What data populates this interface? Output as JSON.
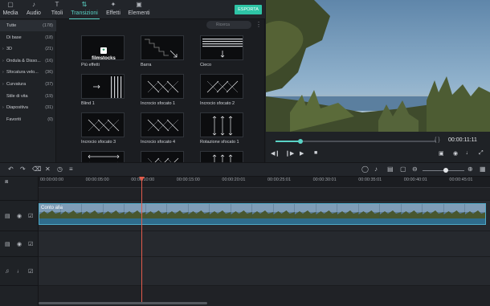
{
  "top_tabs": [
    {
      "label": "Media",
      "icon": "folder-icon"
    },
    {
      "label": "Audio",
      "icon": "music-note-icon"
    },
    {
      "label": "Titoli",
      "icon": "text-icon"
    },
    {
      "label": "Transizioni",
      "icon": "transition-icon",
      "active": true
    },
    {
      "label": "Effetti",
      "icon": "effects-icon"
    },
    {
      "label": "Elementi",
      "icon": "elements-icon"
    }
  ],
  "export_label": "ESPORTA",
  "search": {
    "placeholder": "Ricerca"
  },
  "categories": [
    {
      "name": "Tutte",
      "count": "(178)",
      "arrow": "",
      "selected": true
    },
    {
      "name": "Di base",
      "count": "(18)",
      "arrow": ""
    },
    {
      "name": "3D",
      "count": "(21)",
      "arrow": "›"
    },
    {
      "name": "Ondula & Disso...",
      "count": "(16)",
      "arrow": "›"
    },
    {
      "name": "Sfocatura velo...",
      "count": "(36)",
      "arrow": "›"
    },
    {
      "name": "Curvatura",
      "count": "(37)",
      "arrow": "›"
    },
    {
      "name": "Stile di vita",
      "count": "(19)",
      "arrow": ""
    },
    {
      "name": "Diapositiva",
      "count": "(31)",
      "arrow": "›"
    },
    {
      "name": "Favoriti",
      "count": "(0)",
      "arrow": ""
    }
  ],
  "transitions": [
    {
      "label": "Più effetti",
      "kind": "filmstocks",
      "logo_text": "filmstocks"
    },
    {
      "label": "Barra",
      "kind": "stairs"
    },
    {
      "label": "Cieco",
      "kind": "blinds-h"
    },
    {
      "label": "Blind 1",
      "kind": "blinds-v"
    },
    {
      "label": "Incrocio sfocato 1",
      "kind": "diag-a"
    },
    {
      "label": "Incrocio sfocato 2",
      "kind": "diag-b"
    },
    {
      "label": "Incrocio sfocato 3",
      "kind": "diag-c"
    },
    {
      "label": "Incrocio sfocato 4",
      "kind": "diag-a"
    },
    {
      "label": "Rotazione sfocato 1",
      "kind": "vert-arrows"
    },
    {
      "label": "",
      "kind": "horiz-arrows"
    },
    {
      "label": "",
      "kind": "diag-b"
    },
    {
      "label": "",
      "kind": "vert-arrows"
    }
  ],
  "preview": {
    "timecode": "00:00:11:11",
    "braces": "{  }",
    "progress": 0.155
  },
  "ruler_ticks": [
    "00:00:00:00",
    "00:00:05:00",
    "00:00:10:00",
    "00:00:15:00",
    "00:00:20:01",
    "00:00:25:01",
    "00:00:30:01",
    "00:00:35:01",
    "00:00:40:01",
    "00:00:45:01"
  ],
  "clip": {
    "label": "Conto alla",
    "color": "#4fa9c7"
  },
  "tracks": [
    {
      "name": "video-track-1",
      "icon": "film-icon"
    },
    {
      "name": "video-track-2",
      "icon": "film-icon"
    },
    {
      "name": "audio-track",
      "icon": "music-note-icon"
    }
  ],
  "colors": {
    "accent": "#5ad3c6",
    "export": "#2ec4a6",
    "playhead": "#e25b4b"
  }
}
